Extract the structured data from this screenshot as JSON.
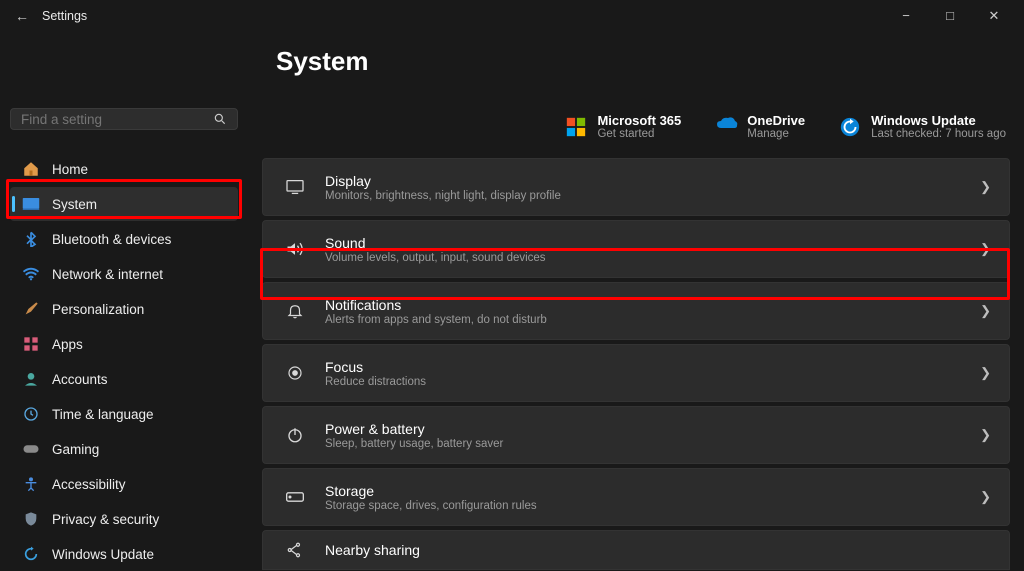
{
  "window": {
    "title": "Settings"
  },
  "header": {
    "title": "System"
  },
  "search": {
    "placeholder": "Find a setting"
  },
  "sidebar": {
    "items": [
      {
        "label": "Home"
      },
      {
        "label": "System"
      },
      {
        "label": "Bluetooth & devices"
      },
      {
        "label": "Network & internet"
      },
      {
        "label": "Personalization"
      },
      {
        "label": "Apps"
      },
      {
        "label": "Accounts"
      },
      {
        "label": "Time & language"
      },
      {
        "label": "Gaming"
      },
      {
        "label": "Accessibility"
      },
      {
        "label": "Privacy & security"
      },
      {
        "label": "Windows Update"
      }
    ]
  },
  "promos": [
    {
      "title": "Microsoft 365",
      "sub": "Get started"
    },
    {
      "title": "OneDrive",
      "sub": "Manage"
    },
    {
      "title": "Windows Update",
      "sub": "Last checked: 7 hours ago"
    }
  ],
  "settings": [
    {
      "title": "Display",
      "sub": "Monitors, brightness, night light, display profile"
    },
    {
      "title": "Sound",
      "sub": "Volume levels, output, input, sound devices"
    },
    {
      "title": "Notifications",
      "sub": "Alerts from apps and system, do not disturb"
    },
    {
      "title": "Focus",
      "sub": "Reduce distractions"
    },
    {
      "title": "Power & battery",
      "sub": "Sleep, battery usage, battery saver"
    },
    {
      "title": "Storage",
      "sub": "Storage space, drives, configuration rules"
    },
    {
      "title": "Nearby sharing",
      "sub": ""
    }
  ]
}
